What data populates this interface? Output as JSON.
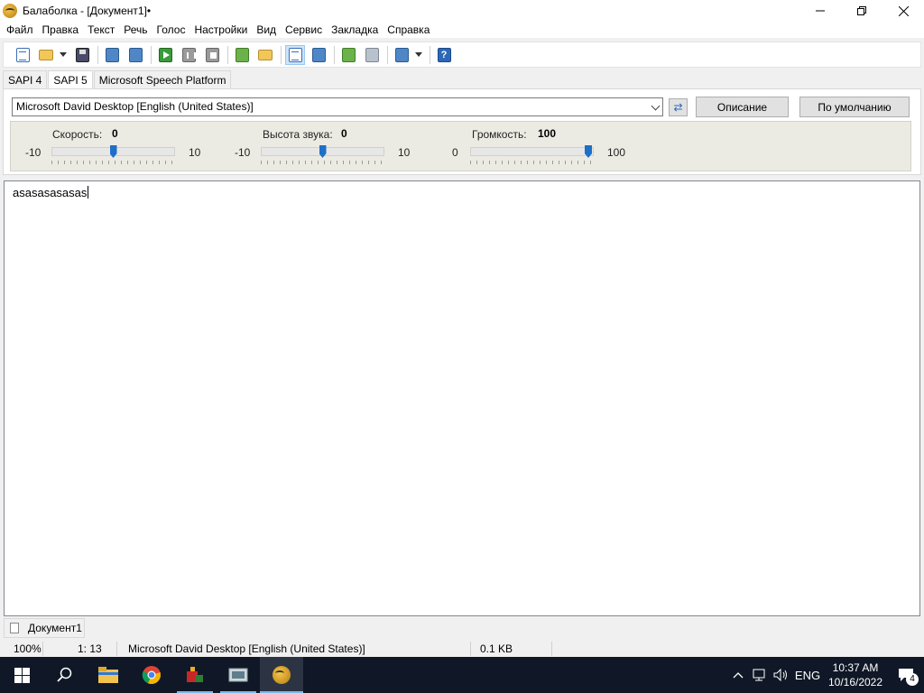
{
  "window": {
    "title": "Балаболка - [Документ1]•"
  },
  "menu": [
    "Файл",
    "Правка",
    "Текст",
    "Речь",
    "Голос",
    "Настройки",
    "Вид",
    "Сервис",
    "Закладка",
    "Справка"
  ],
  "sapi_tabs": [
    "SAPI 4",
    "SAPI 5",
    "Microsoft Speech Platform"
  ],
  "voice": {
    "selected": "Microsoft David Desktop [English (United States)]",
    "description_button": "Описание",
    "default_button": "По умолчанию"
  },
  "sliders": {
    "rate": {
      "label": "Скорость:",
      "value": "0",
      "min": "-10",
      "max": "10",
      "level": 0.5
    },
    "pitch": {
      "label": "Высота звука:",
      "value": "0",
      "min": "-10",
      "max": "10",
      "level": 0.5
    },
    "volume": {
      "label": "Громкость:",
      "value": "100",
      "min": "0",
      "max": "100",
      "level": 1.0
    }
  },
  "editor": {
    "text": "asasasasasas"
  },
  "doc_tab": {
    "label": "Документ1"
  },
  "status": {
    "zoom": "100%",
    "position": "1:  13",
    "voice": "Microsoft David Desktop [English (United States)]",
    "size": "0.1 KB"
  },
  "taskbar": {
    "language": "ENG",
    "time": "10:37 AM",
    "date": "10/16/2022",
    "notifications": "4"
  },
  "icons": [
    "new-document-icon",
    "open-folder-icon",
    "save-icon",
    "play-icon",
    "pause-icon",
    "stop-icon",
    "help-icon",
    "refresh-icon"
  ]
}
